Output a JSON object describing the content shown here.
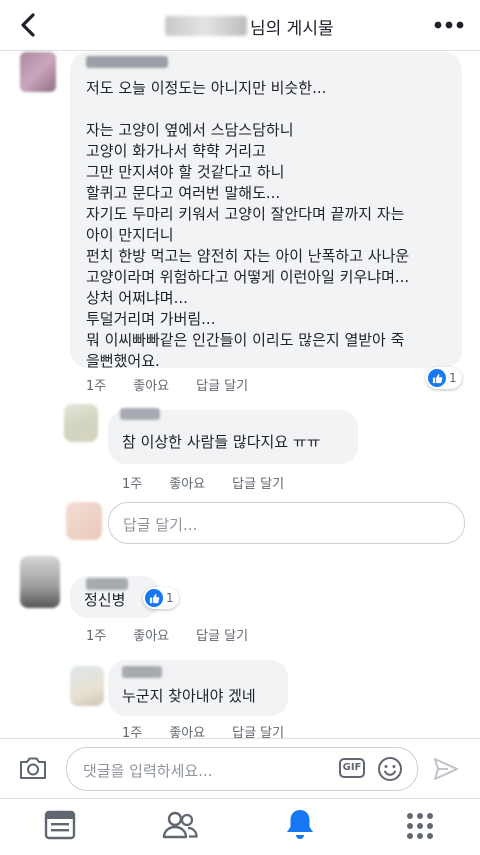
{
  "header": {
    "title": "님의 게시물",
    "back_icon": "chevron-left-icon",
    "more_icon": "more-dots-icon"
  },
  "comments": [
    {
      "text": "저도 오늘 이정도는 아니지만 비슷한...\n\n자는 고양이 옆에서 스담스담하니\n고양이 화가나서 햑햑 거리고\n그만 만지셔야 할 것같다고 하니\n할퀴고 문다고 여러번 말해도...\n자기도 두마리 키워서 고양이 잘안다며 끝까지 자는\n아이 만지더니\n펀치 한방 먹고는 얌전히 자는 아이 난폭하고 사나운\n고양이라며 위험하다고 어떻게 이런아일 키우냐며...\n상처 어쩌냐며...\n투덜거리며 가버림...\n뭐 이씨빠빠같은 인간들이 이리도 많은지 열받아 죽\n을뻔했어요.",
      "time": "1주",
      "like": "좋아요",
      "reply": "답글 달기",
      "likes": "1"
    },
    {
      "text": "참 이상한 사람들 많다지요 ㅠㅠ",
      "time": "1주",
      "like": "좋아요",
      "reply": "답글 달기"
    },
    {
      "text": "정신병",
      "time": "1주",
      "like": "좋아요",
      "reply": "답글 달기",
      "likes": "1"
    },
    {
      "text": "누군지 찾아내야 겠네",
      "time": "1주",
      "like": "좋아요",
      "reply": "답글 달기"
    }
  ],
  "reply_input": {
    "placeholder": "답글 달기..."
  },
  "composer": {
    "placeholder": "댓글을 입력하세요...",
    "gif_label": "GIF",
    "camera_icon": "camera-icon",
    "emoji_icon": "emoji-icon",
    "send_icon": "send-icon"
  },
  "tabbar": {
    "items": [
      "news-feed-icon",
      "friends-icon",
      "notifications-bell-icon",
      "menu-grid-icon"
    ],
    "active": "notifications-bell-icon"
  },
  "colors": {
    "accent": "#1877f2",
    "bubble": "#f2f3f5",
    "meta_text": "#606770",
    "placeholder": "#8d949e"
  }
}
